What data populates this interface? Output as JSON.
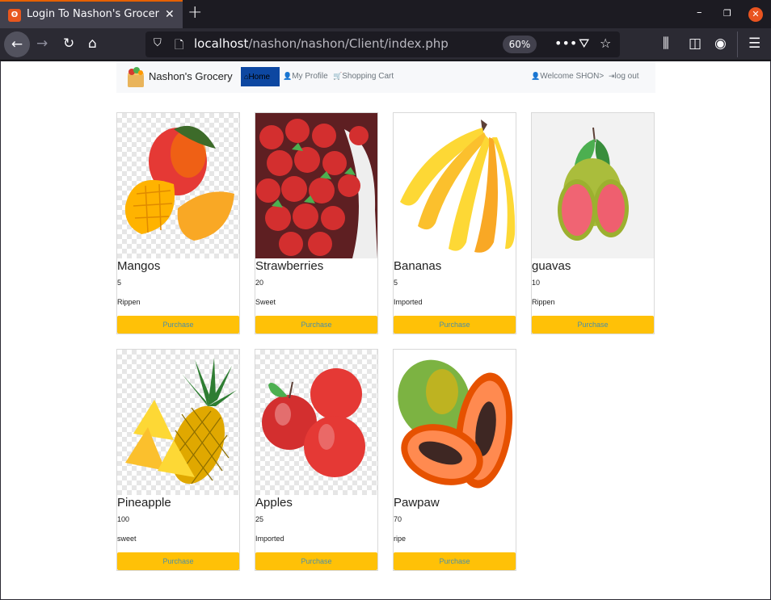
{
  "browser": {
    "tab_title": "Login To Nashon's Grocer",
    "tab_favicon": "xampp-icon",
    "url_host": "localhost",
    "url_path": "/nashon/nashon/Client/index.php",
    "zoom": "60%"
  },
  "site": {
    "brand": "Nashon's Grocery",
    "nav": {
      "home": "Home",
      "profile": "My Profile",
      "cart": "Shopping Cart",
      "welcome": "Welcome SHON>",
      "logout": "log out"
    }
  },
  "products": [
    {
      "name": "Mangos",
      "qty": "5",
      "desc": "Rippen",
      "button": "Purchase"
    },
    {
      "name": "Strawberries",
      "qty": "20",
      "desc": "Sweet",
      "button": "Purchase"
    },
    {
      "name": "Bananas",
      "qty": "5",
      "desc": "Imported",
      "button": "Purchase"
    },
    {
      "name": "guavas",
      "qty": "10",
      "desc": "Rippen",
      "button": "Purchase"
    },
    {
      "name": "Pineapple",
      "qty": "100",
      "desc": "sweet",
      "button": "Purchase"
    },
    {
      "name": "Apples",
      "qty": "25",
      "desc": "Imported",
      "button": "Purchase"
    },
    {
      "name": "Pawpaw",
      "qty": "70",
      "desc": "ripe",
      "button": "Purchase"
    }
  ],
  "colors": {
    "button_bg": "#ffc107",
    "button_text": "#4a8fa8",
    "nav_active_bg": "#0d47a1",
    "tab_accent": "#e66000"
  }
}
